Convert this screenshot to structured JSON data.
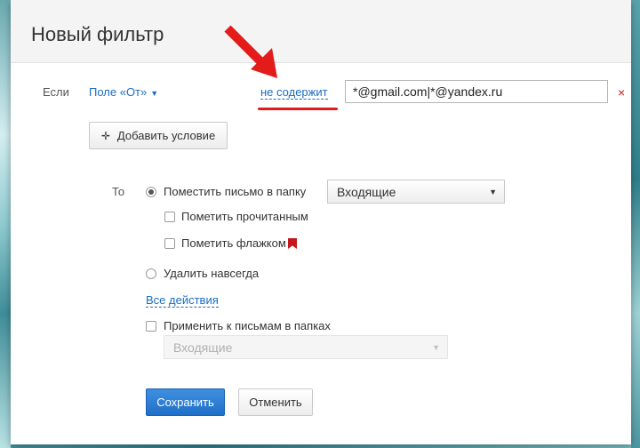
{
  "dialog": {
    "title": "Новый фильтр"
  },
  "condition": {
    "if_label": "Если",
    "field": "Поле «От»",
    "operator": "не содержит",
    "value": "*@gmail.com|*@yandex.ru",
    "remove_icon": "×",
    "add_condition_label": "Добавить условие"
  },
  "actions": {
    "to_label": "То",
    "move_to_folder": {
      "label": "Поместить письмо в папку",
      "selected": true
    },
    "folder_select_value": "Входящие",
    "mark_read": {
      "label": "Пометить прочитанным",
      "checked": false
    },
    "mark_flag": {
      "label": "Пометить флажком",
      "checked": false
    },
    "delete_forever": {
      "label": "Удалить навсегда",
      "selected": false
    },
    "all_actions_link": "Все действия",
    "apply_to_folders": {
      "label": "Применить к письмам в папках",
      "checked": false
    },
    "apply_folder_select_value": "Входящие"
  },
  "footer": {
    "save_label": "Сохранить",
    "cancel_label": "Отменить"
  },
  "colors": {
    "accent": "#1a6dbf",
    "primary_button": "#2a7dd6",
    "remove": "#dd1111",
    "annotation": "#e31b1b",
    "flag": "#c4161c"
  }
}
